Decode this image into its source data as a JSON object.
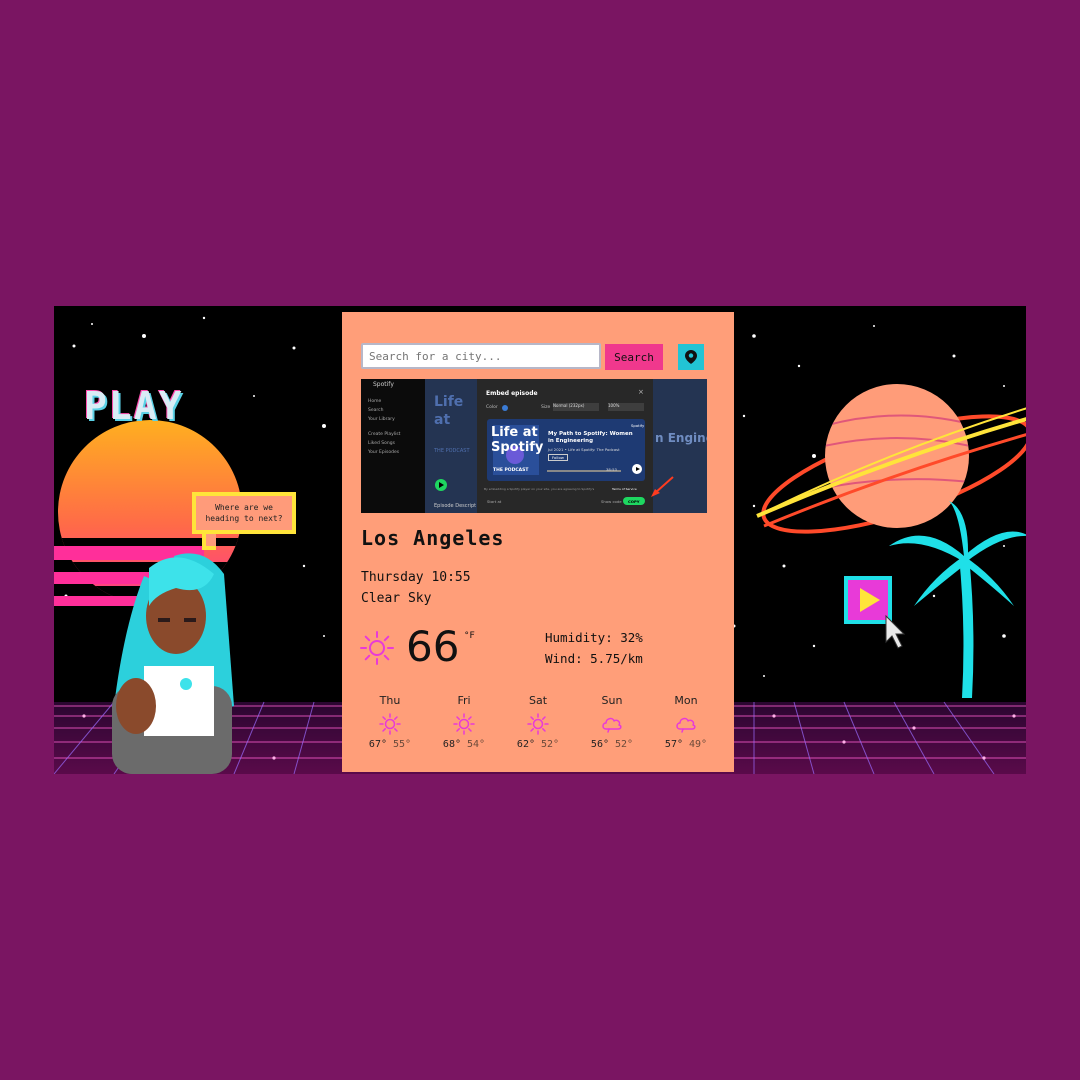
{
  "decor": {
    "play_sign": "PLAY",
    "speech_bubble": "Where are we\nheading to next?"
  },
  "search": {
    "placeholder": "Search for a city...",
    "button_label": "Search",
    "location_icon": "map-pin-icon"
  },
  "embed_screenshot": {
    "app_name": "Spotify",
    "sidebar_items": [
      "Home",
      "Search",
      "Your Library",
      "Create Playlist",
      "Liked Songs",
      "Your Episodes"
    ],
    "bg_title": "Life at Spotify",
    "bg_sub": "THE PODCAST",
    "bg_right_text": "n Enginee",
    "episode_description": "Episode Descript",
    "modal_title": "Embed episode",
    "color_label": "Color",
    "size_label": "Size",
    "size_value": "Normal (232px)",
    "width_value": "100%",
    "card_title": "Life at Spotify",
    "card_sub": "THE PODCAST",
    "episode_title": "My Path to Spotify: Women in Engineering",
    "episode_meta": "Jul 2021 • Life at Spotify: The Podcast",
    "follow_label": "Follow",
    "duration": "38:53",
    "footer_text": "By embedding a Spotify player on your site, you are agreeing to Spotify's",
    "terms_label": "Terms of Service",
    "start_at_label": "Start at",
    "show_code_label": "Show code",
    "copy_label": "COPY"
  },
  "weather": {
    "city": "Los Angeles",
    "datetime": "Thursday 10:55",
    "description": "Clear Sky",
    "temperature": "66",
    "unit": "°F",
    "humidity": "Humidity: 32%",
    "wind": "Wind: 5.75/km",
    "condition_icon": "sun-icon"
  },
  "forecast": [
    {
      "day": "Thu",
      "high": "67°",
      "low": "55°",
      "icon": "sun-icon"
    },
    {
      "day": "Fri",
      "high": "68°",
      "low": "54°",
      "icon": "sun-icon"
    },
    {
      "day": "Sat",
      "high": "62°",
      "low": "52°",
      "icon": "sun-icon"
    },
    {
      "day": "Sun",
      "high": "56°",
      "low": "52°",
      "icon": "cloud-icon"
    },
    {
      "day": "Mon",
      "high": "57°",
      "low": "49°",
      "icon": "cloud-icon"
    }
  ],
  "colors": {
    "page_bg": "#7a1562",
    "card_bg": "#ff9e79",
    "accent_pink": "#f0388d",
    "accent_cyan": "#22c4d4",
    "icon_magenta": "#e83ad8"
  }
}
